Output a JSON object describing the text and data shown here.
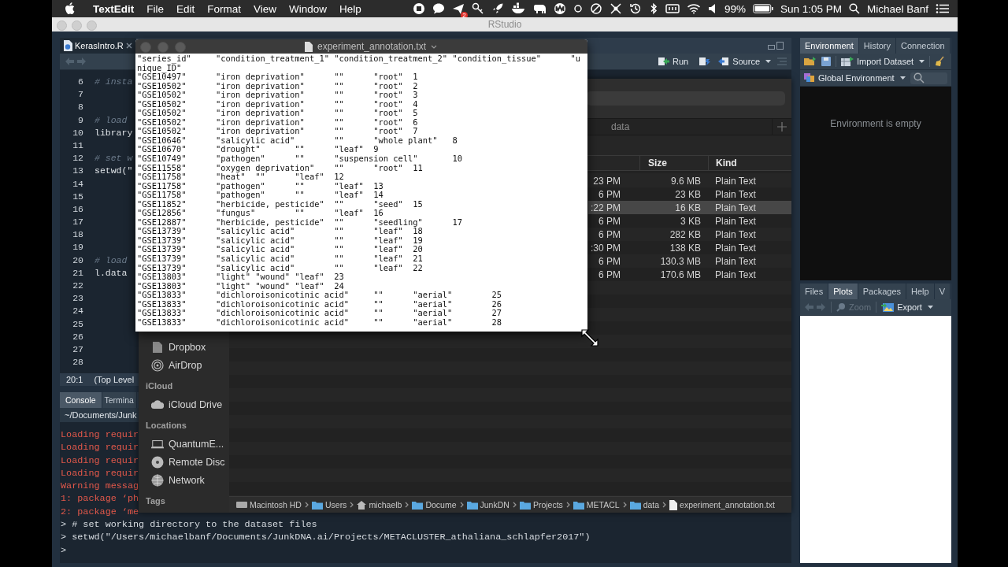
{
  "menu_bar": {
    "app_name": "TextEdit",
    "menus": [
      "File",
      "Edit",
      "Format",
      "View",
      "Window",
      "Help"
    ],
    "badge": "2",
    "battery": "99%",
    "clock": "Sun 1:05 PM",
    "user": "Michael Banf"
  },
  "rstudio": {
    "title": "RStudio",
    "source": {
      "tabs": [
        {
          "label": "KerasIntro.R",
          "selected": true
        }
      ],
      "run": "Run",
      "source": "Source",
      "lines": [
        {
          "number": "6",
          "kind": "comment",
          "code": "# insta"
        },
        {
          "number": "7",
          "kind": "blank"
        },
        {
          "number": "8",
          "kind": "blank"
        },
        {
          "number": "9",
          "kind": "comment",
          "code": "# load"
        },
        {
          "number": "10",
          "kind": "code",
          "code": "library"
        },
        {
          "number": "11",
          "kind": "blank"
        },
        {
          "number": "12",
          "kind": "comment",
          "code": "# set w"
        },
        {
          "number": "13",
          "kind": "code",
          "code": "setwd(\""
        },
        {
          "number": "14",
          "kind": "blank"
        },
        {
          "number": "15",
          "kind": "blank"
        },
        {
          "number": "16",
          "kind": "blank"
        },
        {
          "number": "17",
          "kind": "blank"
        },
        {
          "number": "18",
          "kind": "blank"
        },
        {
          "number": "19",
          "kind": "blank"
        },
        {
          "number": "20",
          "kind": "comment",
          "code": "# load"
        },
        {
          "number": "21",
          "kind": "code",
          "code": "l.data"
        },
        {
          "number": "22",
          "kind": "blank"
        },
        {
          "number": "23",
          "kind": "blank"
        },
        {
          "number": "24",
          "kind": "blank"
        },
        {
          "number": "25",
          "kind": "blank"
        },
        {
          "number": "26",
          "kind": "blank"
        },
        {
          "number": "27",
          "kind": "blank"
        },
        {
          "number": "28",
          "kind": "blank"
        }
      ],
      "cursor": "20:1",
      "scope": "(Top Level"
    },
    "console": {
      "tabs": [
        {
          "label": "Console",
          "selected": true
        },
        {
          "label": "Termina",
          "selected": false
        }
      ],
      "path": "~/Documents/Junk",
      "lines": [
        {
          "kind": "message",
          "text": "Loading requir"
        },
        {
          "kind": "message",
          "text": "Loading requir"
        },
        {
          "kind": "message",
          "text": "Loading requir"
        },
        {
          "kind": "message",
          "text": "Loading requir"
        },
        {
          "kind": "message",
          "text": "Warning messag"
        },
        {
          "kind": "message",
          "text": "1: package ‘ph"
        },
        {
          "kind": "message",
          "text": "2: package ‘me"
        },
        {
          "kind": "input",
          "text": "> # set working directory to the dataset files"
        },
        {
          "kind": "input",
          "text": "> setwd(\"/Users/michaelbanf/Documents/JunkDNA.ai/Projects/METACLUSTER_athaliana_schlapfer2017\")"
        },
        {
          "kind": "input",
          "text": ">"
        }
      ]
    },
    "environment": {
      "tabs": [
        {
          "label": "Environment",
          "selected": true
        },
        {
          "label": "History",
          "selected": false
        },
        {
          "label": "Connection",
          "selected": false
        }
      ],
      "import": "Import Dataset",
      "scope": "Global Environment",
      "message": "Environment is empty"
    },
    "viewer": {
      "tabs": [
        {
          "label": "Files",
          "selected": false
        },
        {
          "label": "Plots",
          "selected": true
        },
        {
          "label": "Packages",
          "selected": false
        },
        {
          "label": "Help",
          "selected": false
        },
        {
          "label": "V",
          "selected": false
        }
      ],
      "zoom": {
        "label": "Zoom",
        "disabled": true
      },
      "export": {
        "label": "Export",
        "disabled": false
      }
    }
  },
  "finder": {
    "tab": "data",
    "columns": [
      "Size",
      "Kind"
    ],
    "rows": [
      {
        "modified": "23 PM",
        "size": "9.6 MB",
        "file_type": "Plain Text",
        "selected": false
      },
      {
        "modified": "6 PM",
        "size": "23 KB",
        "file_type": "Plain Text",
        "selected": false
      },
      {
        "modified": ":22 PM",
        "size": "16 KB",
        "file_type": "Plain Text",
        "selected": true
      },
      {
        "modified": "6 PM",
        "size": "3 KB",
        "file_type": "Plain Text",
        "selected": false
      },
      {
        "modified": "6 PM",
        "size": "282 KB",
        "file_type": "Plain Text",
        "selected": false
      },
      {
        "modified": ":30 PM",
        "size": "138 KB",
        "file_type": "Plain Text",
        "selected": false
      },
      {
        "modified": "6 PM",
        "size": "130.3 MB",
        "file_type": "Plain Text",
        "selected": false
      },
      {
        "modified": "6 PM",
        "size": "170.6 MB",
        "file_type": "Plain Text",
        "selected": false
      }
    ],
    "sidebar": [
      {
        "kind": "item",
        "label": "Dropbox"
      },
      {
        "kind": "item",
        "label": "AirDrop"
      },
      {
        "kind": "header",
        "label": "iCloud"
      },
      {
        "kind": "item",
        "label": "iCloud Drive"
      },
      {
        "kind": "header",
        "label": "Locations"
      },
      {
        "kind": "item",
        "label": "QuantumE..."
      },
      {
        "kind": "item",
        "label": "Remote Disc"
      },
      {
        "kind": "item",
        "label": "Network"
      },
      {
        "kind": "header",
        "label": "Tags"
      }
    ],
    "path": [
      "Macintosh HD",
      "Users",
      "michaelb",
      "Docume",
      "JunkDN",
      "Projects",
      "METACL",
      "data",
      "experiment_annotation.txt"
    ]
  },
  "textedit": {
    "title": "experiment_annotation.txt",
    "lines": [
      "\"series_id\"\t\"condition_treatment_1\"\t\"condition_treatment_2\"\t\"condition_tissue\"\t\"u",
      "nique_ID\"",
      "\"GSE10497\"\t\"iron deprivation\"\t\"\"\t\"root\"\t1",
      "\"GSE10502\"\t\"iron deprivation\"\t\"\"\t\"root\"\t2",
      "\"GSE10502\"\t\"iron deprivation\"\t\"\"\t\"root\"\t3",
      "\"GSE10502\"\t\"iron deprivation\"\t\"\"\t\"root\"\t4",
      "\"GSE10502\"\t\"iron deprivation\"\t\"\"\t\"root\"\t5",
      "\"GSE10502\"\t\"iron deprivation\"\t\"\"\t\"root\"\t6",
      "\"GSE10502\"\t\"iron deprivation\"\t\"\"\t\"root\"\t7",
      "\"GSE10646\"\t\"salicylic acid\"\t\"\"\t\"whole plant\"\t8",
      "\"GSE10670\"\t\"drought\"\t\"\"\t\"leaf\"\t9",
      "\"GSE10749\"\t\"pathogen\"\t\"\"\t\"suspension cell\"\t10",
      "\"GSE11558\"\t\"oxygen deprivation\"\t\"\"\t\"root\"\t11",
      "\"GSE11758\"\t\"heat\"\t\"\"\t\"leaf\"\t12",
      "\"GSE11758\"\t\"pathogen\"\t\"\"\t\"leaf\"\t13",
      "\"GSE11758\"\t\"pathogen\"\t\"\"\t\"leaf\"\t14",
      "\"GSE11852\"\t\"herbicide, pesticide\"\t\"\"\t\"seed\"\t15",
      "\"GSE12856\"\t\"fungus\"\t\"\"\t\"leaf\"\t16",
      "\"GSE12887\"\t\"herbicide, pesticide\"\t\"\"\t\"seedling\"\t17",
      "\"GSE13739\"\t\"salicylic acid\"\t\"\"\t\"leaf\"\t18",
      "\"GSE13739\"\t\"salicylic acid\"\t\"\"\t\"leaf\"\t19",
      "\"GSE13739\"\t\"salicylic acid\"\t\"\"\t\"leaf\"\t20",
      "\"GSE13739\"\t\"salicylic acid\"\t\"\"\t\"leaf\"\t21",
      "\"GSE13739\"\t\"salicylic acid\"\t\"\"\t\"leaf\"\t22",
      "\"GSE13803\"\t\"light\"\t\"wound\"\t\"leaf\"\t23",
      "\"GSE13803\"\t\"light\"\t\"wound\"\t\"leaf\"\t24",
      "\"GSE13833\"\t\"dichloroisonicotinic acid\"\t\"\"\t\"aerial\"\t25",
      "\"GSE13833\"\t\"dichloroisonicotinic acid\"\t\"\"\t\"aerial\"\t26",
      "\"GSE13833\"\t\"dichloroisonicotinic acid\"\t\"\"\t\"aerial\"\t27",
      "\"GSE13833\"\t\"dichloroisonicotinic acid\"\t\"\"\t\"aerial\"\t28"
    ]
  }
}
